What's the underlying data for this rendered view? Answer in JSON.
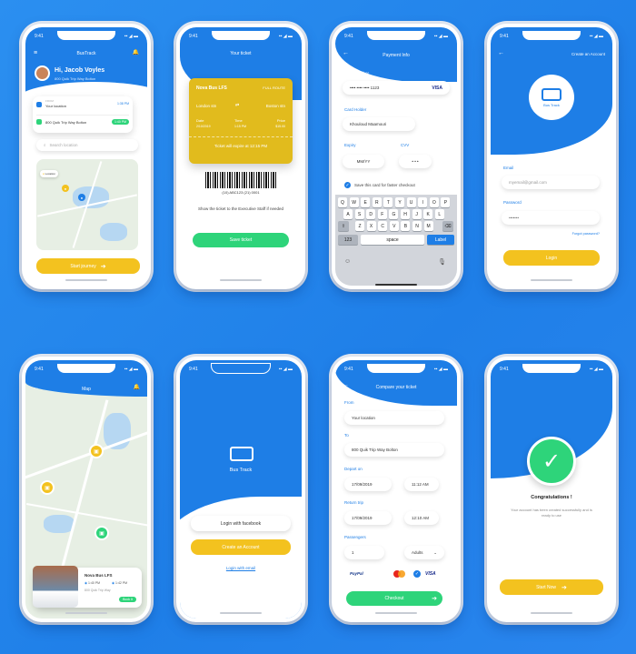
{
  "common": {
    "time": "9:41"
  },
  "home": {
    "title": "BusTrack",
    "greeting": "Hi, Jacob Voyles",
    "address": "800 Quik Trip Way Bolton",
    "from": "Your location",
    "from_caption": "FROM",
    "to": "800 Quik Trip Way Bolton",
    "to_caption": "TO",
    "search_placeholder": "Search location",
    "start_label": "Start journey",
    "badge1": "1:38 PM",
    "badge2": "1:40 PM"
  },
  "ticket": {
    "title": "Your ticket",
    "bus": "Nova Bus LFS",
    "route": "FULL ROUTE",
    "from": "London stn",
    "to": "Boston stn",
    "date_label": "Date",
    "date": "2/10/2019",
    "time_label": "Time",
    "time": "1:15 PM",
    "price_label": "Price",
    "price": "$15.00",
    "expire": "Ticket will expire at 12:15 PM",
    "code": "(10) ABC123 (21) 0001",
    "note": "Show the ticket to the Executive Staff if needed",
    "save_label": "Save ticket"
  },
  "payment": {
    "title": "Payment Info",
    "card_label": "Card Number",
    "card_number": "•••• •••• •••• 1123",
    "brand": "VISA",
    "holder_label": "Card Holder",
    "holder": "Khouloud Maamouri",
    "expiry_label": "Expiry",
    "expiry": "MM/YY",
    "cvv_label": "CVV",
    "cvv": "• • •",
    "save_card": "Save this card for faster checkout",
    "keys_row1": [
      "Q",
      "W",
      "E",
      "R",
      "T",
      "Y",
      "U",
      "I",
      "O",
      "P"
    ],
    "keys_row2": [
      "A",
      "S",
      "D",
      "F",
      "G",
      "H",
      "J",
      "K",
      "L"
    ],
    "keys_row3": [
      "Z",
      "X",
      "C",
      "V",
      "B",
      "N",
      "M"
    ],
    "k123": "123",
    "space": "space",
    "label_key": "Label"
  },
  "create": {
    "title": "Create an Account",
    "logo": "Bus Track",
    "email_label": "Email",
    "email": "myemail@gmail.com",
    "password_label": "Password",
    "password": "•••••••",
    "forgot": "Forgot password?",
    "login": "Login"
  },
  "map": {
    "title": "Map",
    "bus": "Nova Bus LFS",
    "t1": "1:40 PM",
    "t2": "1:42 PM",
    "stop": "800 Quik Trip Way",
    "book": "Book It"
  },
  "welcome": {
    "logo": "Bus Track",
    "facebook": "Login with facebook",
    "create": "Create an Account",
    "email": "Login with email"
  },
  "compare": {
    "title": "Compare your ticket",
    "from_label": "From",
    "from": "Your location",
    "to_label": "To",
    "to": "800 Quik Trip Way Bolton",
    "depart_label": "Depart on",
    "depart_date": "17/09/2019",
    "depart_time": "11:12 AM",
    "return_label": "Return trip",
    "return_date": "17/09/2019",
    "return_time": "12:10 AM",
    "passengers_label": "Passengers",
    "passengers": "1",
    "type": "Adults",
    "paypal": "PayPal",
    "visa": "VISA",
    "checkout": "Checkout"
  },
  "success": {
    "title": "Congratulations !",
    "message": "Your account has been created successfully and is ready to use",
    "start": "Start Now"
  }
}
